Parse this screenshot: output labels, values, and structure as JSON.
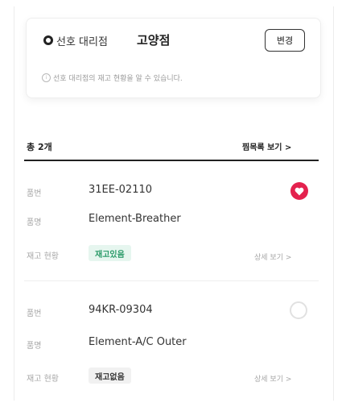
{
  "dealer": {
    "label": "선호 대리점",
    "name": "고양점",
    "change_label": "변경",
    "info": "선호 대리점의 재고 현황을 알 수 있습니다."
  },
  "list": {
    "total": "총 2개",
    "view_all": "찜목록 보기 >"
  },
  "labels": {
    "part_no": "품번",
    "part_name": "품명",
    "stock": "재고 현황",
    "detail": "상세 보기 >"
  },
  "items": [
    {
      "part_no": "31EE-02110",
      "part_name": "Element-Breather",
      "stock": "재고있음",
      "favorited": true
    },
    {
      "part_no": "94KR-09304",
      "part_name": "Element-A/C Outer",
      "stock": "재고없음",
      "favorited": false
    }
  ],
  "colors": {
    "favorite": "#e4224e",
    "in_stock": "#2a9a68"
  },
  "icons": {
    "favorite_on": "heart-icon",
    "favorite_off": "circle-icon",
    "preferred": "location-icon"
  }
}
